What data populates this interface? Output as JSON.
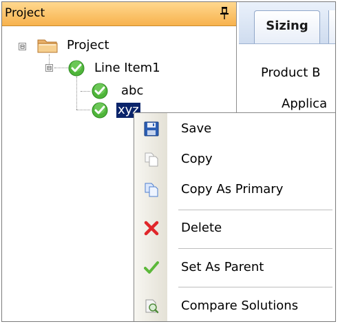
{
  "project_pane": {
    "title": "Project",
    "pin_icon": "pin-icon"
  },
  "tree": {
    "root": {
      "label": "Project",
      "expander": "⊟",
      "icon": "folder-icon"
    },
    "line_item": {
      "label": "Line Item1",
      "expander": "⊟",
      "icon": "green-check-icon"
    },
    "children": [
      {
        "label": "abc",
        "icon": "green-check-icon",
        "selected": false
      },
      {
        "label": "xyz",
        "icon": "green-check-icon",
        "selected": true
      }
    ]
  },
  "tabs": {
    "sizing_label": "Sizing"
  },
  "form": {
    "product_label": "Product B",
    "application_label": "Applica"
  },
  "context_menu": {
    "items": [
      {
        "label": "Save",
        "icon": "save-icon"
      },
      {
        "label": "Copy",
        "icon": "copy-icon"
      },
      {
        "label": "Copy As Primary",
        "icon": "copy-primary-icon"
      },
      {
        "label": "Delete",
        "icon": "delete-icon"
      },
      {
        "label": "Set As Parent",
        "icon": "checkmark-icon"
      },
      {
        "label": "Compare Solutions",
        "icon": "compare-icon"
      }
    ]
  },
  "colors": {
    "header_orange": "#f7b24d",
    "selection_blue": "#0a246a",
    "check_green": "#3fae2a",
    "delete_red": "#e0262a"
  }
}
